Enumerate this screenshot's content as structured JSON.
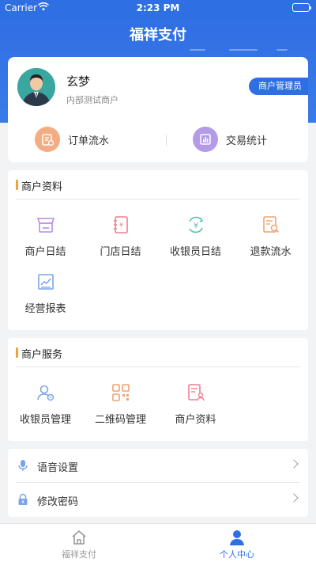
{
  "status_bar": {
    "carrier": "Carrier",
    "time": "2:23 PM"
  },
  "header": {
    "title": "福祥支付"
  },
  "profile": {
    "name": "玄梦",
    "description": "内部测试商户",
    "role_badge": "商户管理员",
    "quick_actions": [
      {
        "label": "订单流水",
        "icon": "order-flow-icon",
        "color": "#f0a36f"
      },
      {
        "label": "交易统计",
        "icon": "trade-stats-icon",
        "color": "#a78be6"
      }
    ]
  },
  "merchant_info": {
    "title": "商户资料",
    "items": [
      {
        "label": "商户日结",
        "icon": "shop-icon",
        "color": "#b78be6"
      },
      {
        "label": "门店日结",
        "icon": "notebook-icon",
        "color": "#ef7f8f"
      },
      {
        "label": "收银员日结",
        "icon": "yen-exchange-icon",
        "color": "#4fc4b2"
      },
      {
        "label": "退款流水",
        "icon": "refund-search-icon",
        "color": "#f0a36f"
      },
      {
        "label": "经营报表",
        "icon": "chart-report-icon",
        "color": "#7aa6e8"
      }
    ]
  },
  "merchant_service": {
    "title": "商户服务",
    "items": [
      {
        "label": "收银员管理",
        "icon": "cashier-manage-icon",
        "color": "#7aa6e8"
      },
      {
        "label": "二维码管理",
        "icon": "qrcode-icon",
        "color": "#f0a36f"
      },
      {
        "label": "商户资料",
        "icon": "merchant-profile-icon",
        "color": "#ef7f8f"
      }
    ]
  },
  "settings": [
    {
      "label": "语音设置",
      "icon": "microphone-icon"
    },
    {
      "label": "修改密码",
      "icon": "lock-icon"
    }
  ],
  "tabs": [
    {
      "label": "福祥支付",
      "icon": "home-icon",
      "active": false
    },
    {
      "label": "个人中心",
      "icon": "person-icon",
      "active": true
    }
  ],
  "colors": {
    "primary": "#2f6fe4",
    "accent_bar": "#f0a33a",
    "inactive_tab": "#999999"
  }
}
